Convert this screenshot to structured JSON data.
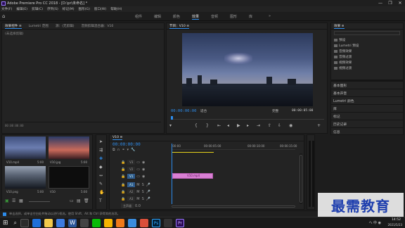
{
  "window": {
    "title": "Adobe Premiere Pro CC 2018 - [D:\\pr\\未命名] *",
    "controls": [
      "—",
      "❐",
      "✕"
    ]
  },
  "menu": [
    "文件(F)",
    "编辑(E)",
    "剪辑(C)",
    "序列(S)",
    "标记(M)",
    "图形(G)",
    "窗口(W)",
    "帮助(H)"
  ],
  "workspaces": {
    "tabs": [
      "组件",
      "编辑",
      "颜色",
      "效果",
      "音频",
      "图形",
      "库"
    ],
    "active_index": 3,
    "more": "»"
  },
  "source_panel": {
    "tabs": [
      "效果控件 ≡",
      "Lumetri 范围",
      "源：(无剪辑)",
      "音频剪辑混合器：V10"
    ],
    "empty_text": "(未选择剪辑)",
    "timecode": "00:00:00:00"
  },
  "program_panel": {
    "tab": "节目：V10 ≡",
    "timecode": "00:00:00:00",
    "fit": "适合",
    "quality": "完整",
    "duration": "00:00:05:00"
  },
  "project_panel": {
    "items": [
      {
        "label": "V10.mp4",
        "duration": "5:00"
      },
      {
        "label": "V10.jpg",
        "duration": "5:00"
      },
      {
        "label": "V10.png",
        "duration": "5:00"
      },
      {
        "label": "V10",
        "duration": "5:00"
      }
    ]
  },
  "timeline": {
    "tab": "V10 ≡",
    "timecode": "00:00:00:00",
    "ruler": [
      ":00:00",
      "00:00:05:00",
      "00:00:10:00",
      "00:00:15:00"
    ],
    "video_tracks": [
      "V3",
      "V2",
      "V1"
    ],
    "audio_tracks": [
      "A1",
      "A2",
      "A3"
    ],
    "master": "主声道",
    "master_value": "0.0",
    "clip_label": "V10.mp4",
    "v1_clip_label": "V10.mp4"
  },
  "effects_panel": {
    "title": "效果 ≡",
    "items": [
      "预设",
      "Lumetri 预设",
      "音频效果",
      "音频过渡",
      "视频效果",
      "视频过渡"
    ]
  },
  "right_panels": [
    "基本图形",
    "基本声音",
    "Lumetri 颜色",
    "库",
    "标记",
    "历史记录",
    "信息"
  ],
  "status": {
    "text": "单击选择，或单击空白处并拖动以进行框选。使用 Shift、Alt 和 Ctrl 获得其他选项。"
  },
  "watermark": "最需教育",
  "taskbar": {
    "time": "14:52",
    "date": "2021/5/23",
    "tray": "へ 中 ◉"
  },
  "colors": {
    "accent": "#2d8ceb",
    "clip": "#d97fd4",
    "watermark": "#1f3fae"
  }
}
